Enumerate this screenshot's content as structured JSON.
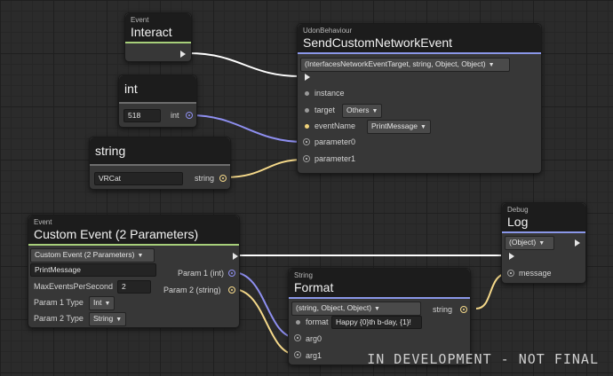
{
  "colors": {
    "event_accent": "#a7cf7a",
    "udon_accent": "#8a97e8",
    "int_wire": "#8e8ff0",
    "string_wire": "#f5d98a",
    "exec_wire": "#ffffff",
    "object_wire": "#bfbfbf"
  },
  "nodes": {
    "interact": {
      "category": "Event",
      "title": "Interact"
    },
    "int_const": {
      "title": "int",
      "value": "518",
      "out_label": "int"
    },
    "string_const": {
      "title": "string",
      "value": "VRCat",
      "out_label": "string"
    },
    "send_custom": {
      "category": "UdonBehaviour",
      "title": "SendCustomNetworkEvent",
      "overload": "(InterfacesNetworkEventTarget, string, Object, Object)",
      "inputs": {
        "instance": "instance",
        "target": "target",
        "target_value": "Others",
        "event_name": "eventName",
        "event_name_value": "PrintMessage",
        "parameter0": "parameter0",
        "parameter1": "parameter1"
      }
    },
    "custom_event": {
      "category": "Event",
      "title": "Custom Event (2 Parameters)",
      "overload": "Custom Event (2 Parameters)",
      "name_value": "PrintMessage",
      "max_events_label": "MaxEventsPerSecond",
      "max_events_value": "2",
      "param1_type_label": "Param 1 Type",
      "param1_type_value": "Int",
      "param2_type_label": "Param 2 Type",
      "param2_type_value": "String",
      "out_param1": "Param 1 (int)",
      "out_param2": "Param 2 (string)"
    },
    "format": {
      "category": "String",
      "title": "Format",
      "overload": "(string, Object, Object)",
      "format_label": "format",
      "format_value": "Happy {0}th b-day, {1}!",
      "arg0": "arg0",
      "arg1": "arg1",
      "out_label": "string"
    },
    "log": {
      "category": "Debug",
      "title": "Log",
      "overload": "(Object)",
      "message": "message"
    }
  },
  "watermark": "IN DEVELOPMENT - NOT FINAL"
}
